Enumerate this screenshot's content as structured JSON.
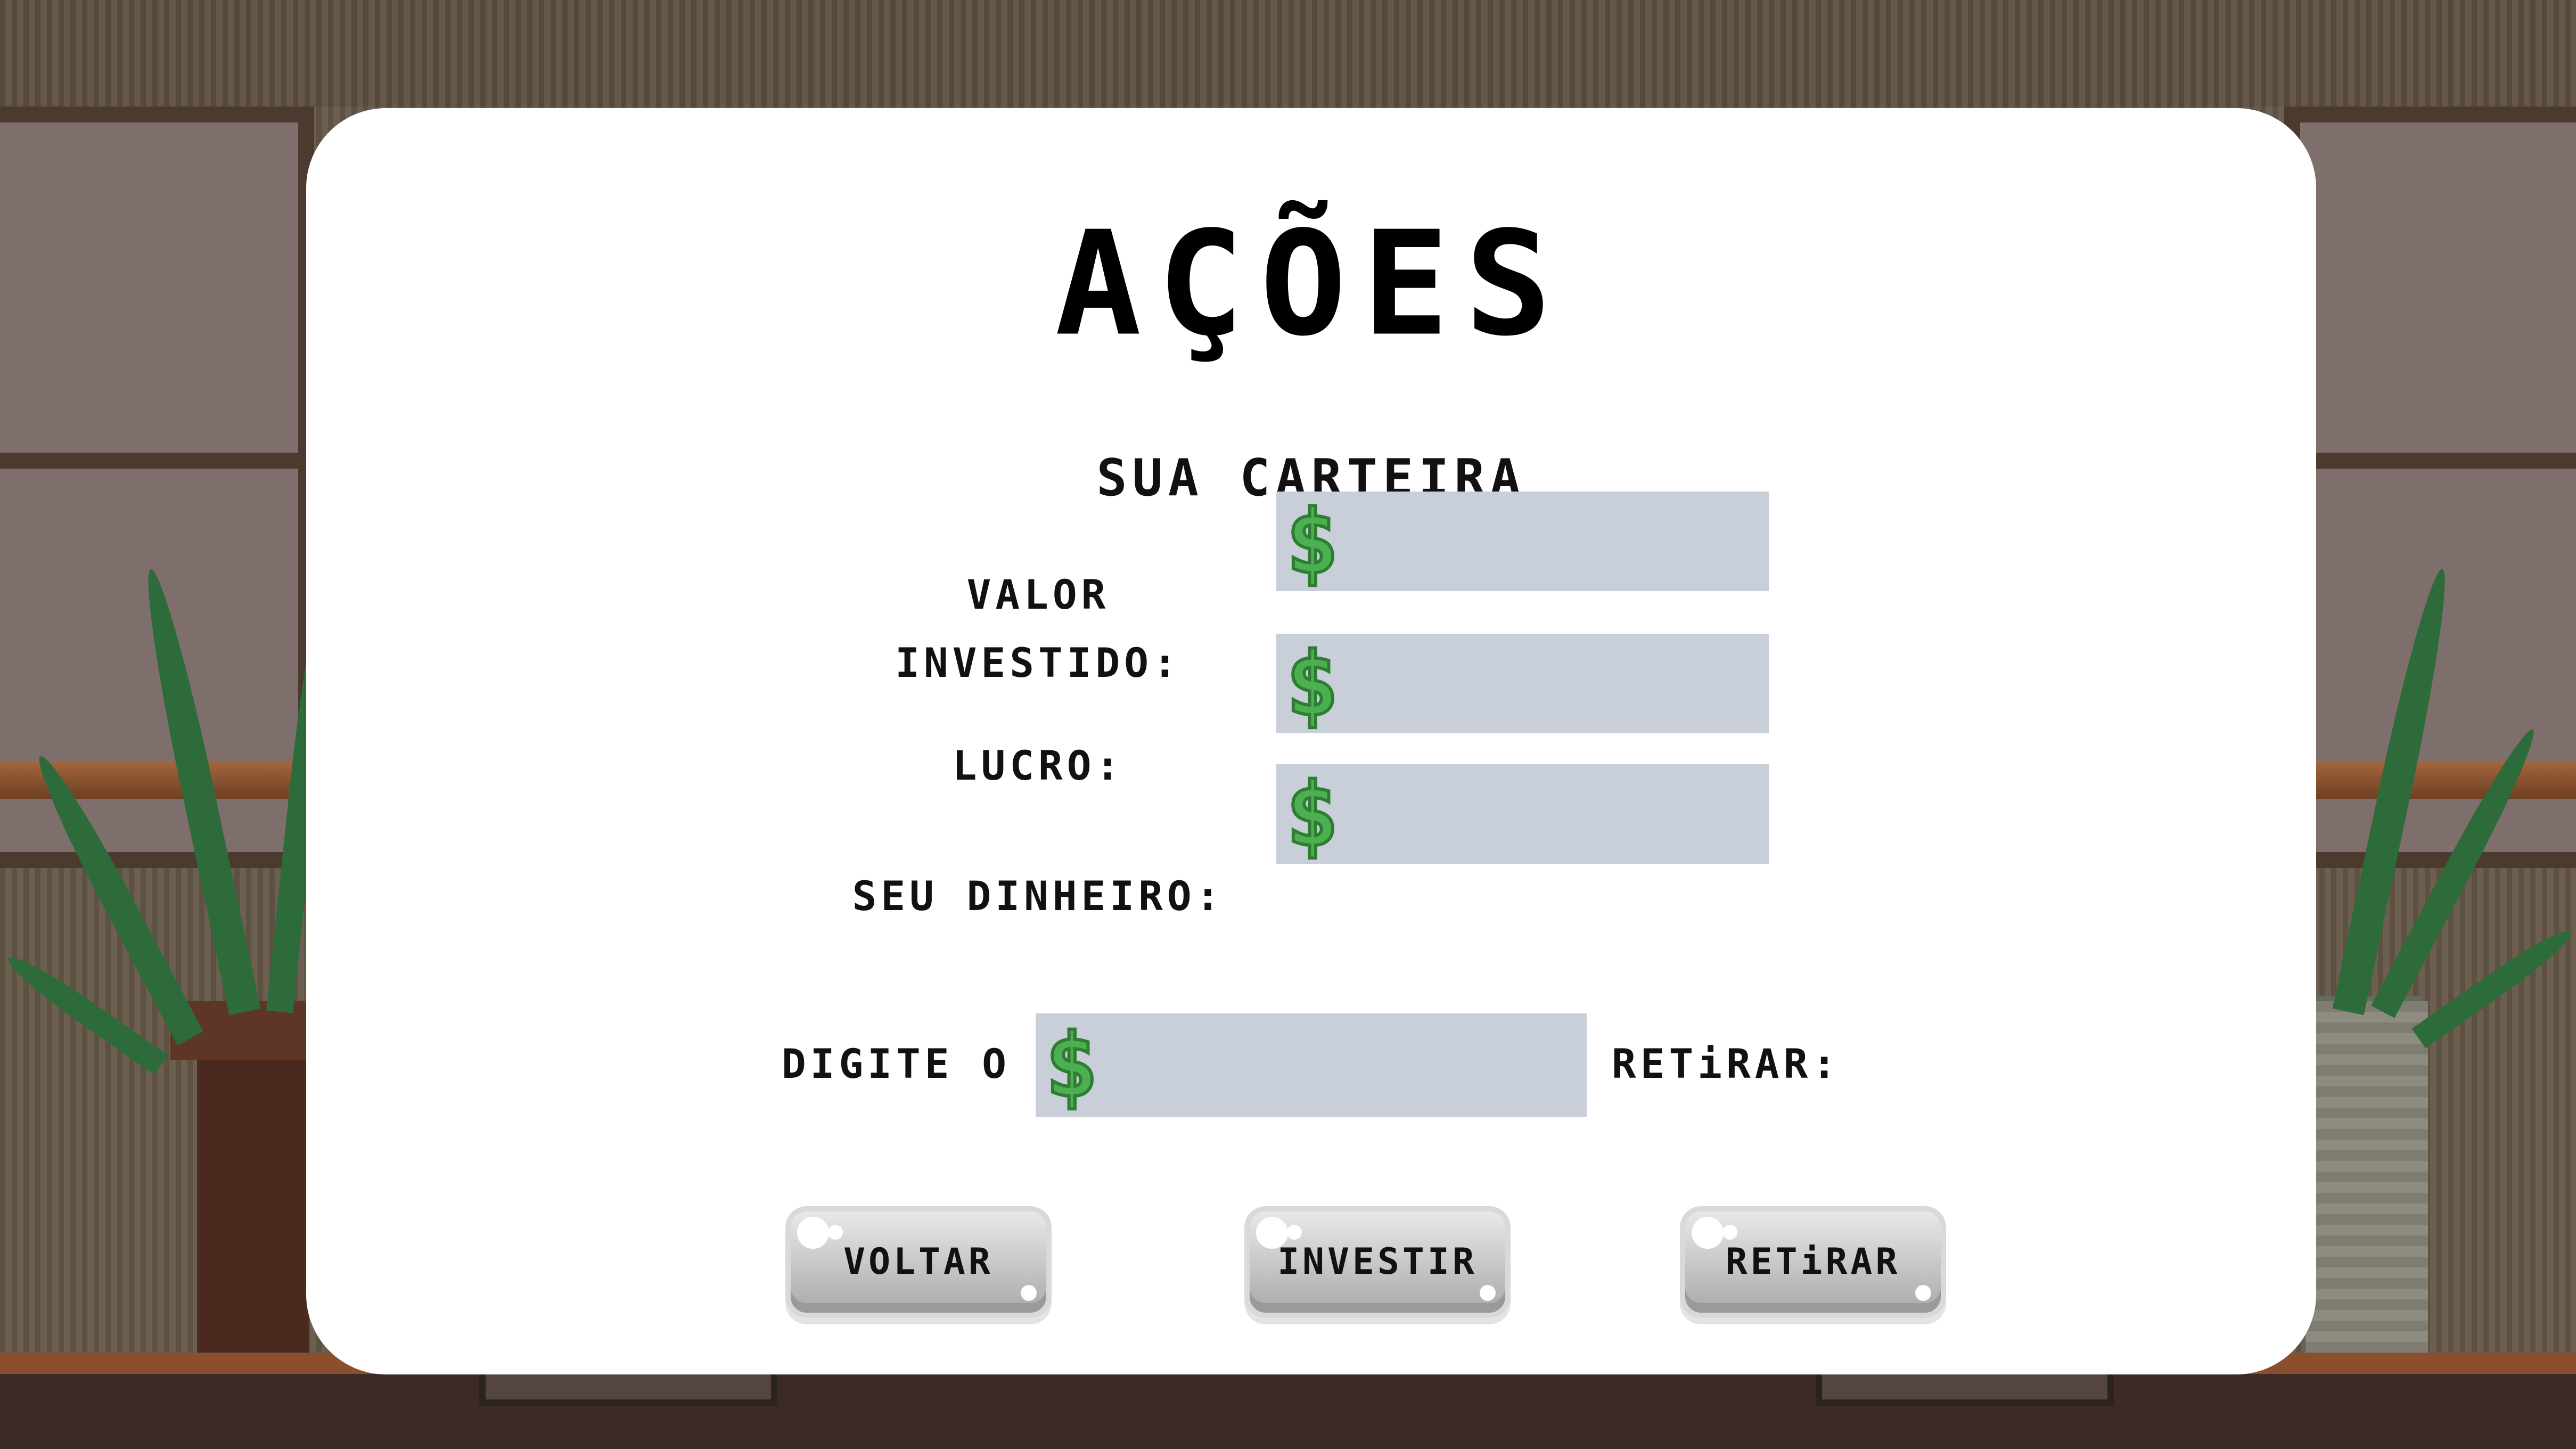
{
  "screen": {
    "title": "AÇÕES",
    "subtitle": "SUA CARTEIRA"
  },
  "portfolio": {
    "invested_label_line1": "VALOR",
    "invested_label_line2": "INVESTIDO:",
    "invested_value": "",
    "profit_label": "LUCRO:",
    "profit_value": "",
    "money_label": "SEU DINHEIRO:",
    "money_value": "",
    "currency_symbol": "$"
  },
  "amount": {
    "prompt": "DIGITE O VALOR A INVESTIR OU RETiRAR:",
    "value": ""
  },
  "buttons": {
    "back": "VOLTAR",
    "invest": "INVESTIR",
    "withdraw": "RETiRAR"
  },
  "colors": {
    "field_bg": "#c8cfd9",
    "currency_green": "#4caf50",
    "modal_bg": "#ffffff"
  }
}
